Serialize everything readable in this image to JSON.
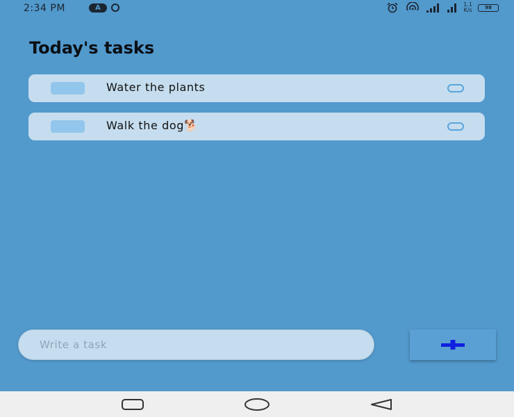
{
  "status_bar": {
    "time": "2:34 PM",
    "left_icons": [
      "vpn-pill-icon",
      "sync-ring-icon"
    ],
    "right_icons": [
      "alarm-icon",
      "hotspot-icon",
      "signal-icon",
      "signal-icon-2"
    ],
    "speed_value": "1.1",
    "speed_unit": "K/s",
    "battery_level": "98",
    "badge_letter": "A"
  },
  "header": {
    "title": "Today's tasks"
  },
  "tasks": [
    {
      "text": "Water the plants"
    },
    {
      "text": "Walk the dog🐕"
    }
  ],
  "composer": {
    "placeholder": "Write a task",
    "add_label": "+"
  },
  "colors": {
    "background": "#5299cc",
    "card": "#c5ddee",
    "checkbox": "#93c6ec",
    "add_plus": "#1020e0",
    "nav_bar": "#efefef"
  },
  "nav_bar": {
    "buttons": [
      "recents-square-icon",
      "home-circle-icon",
      "back-triangle-icon"
    ]
  }
}
